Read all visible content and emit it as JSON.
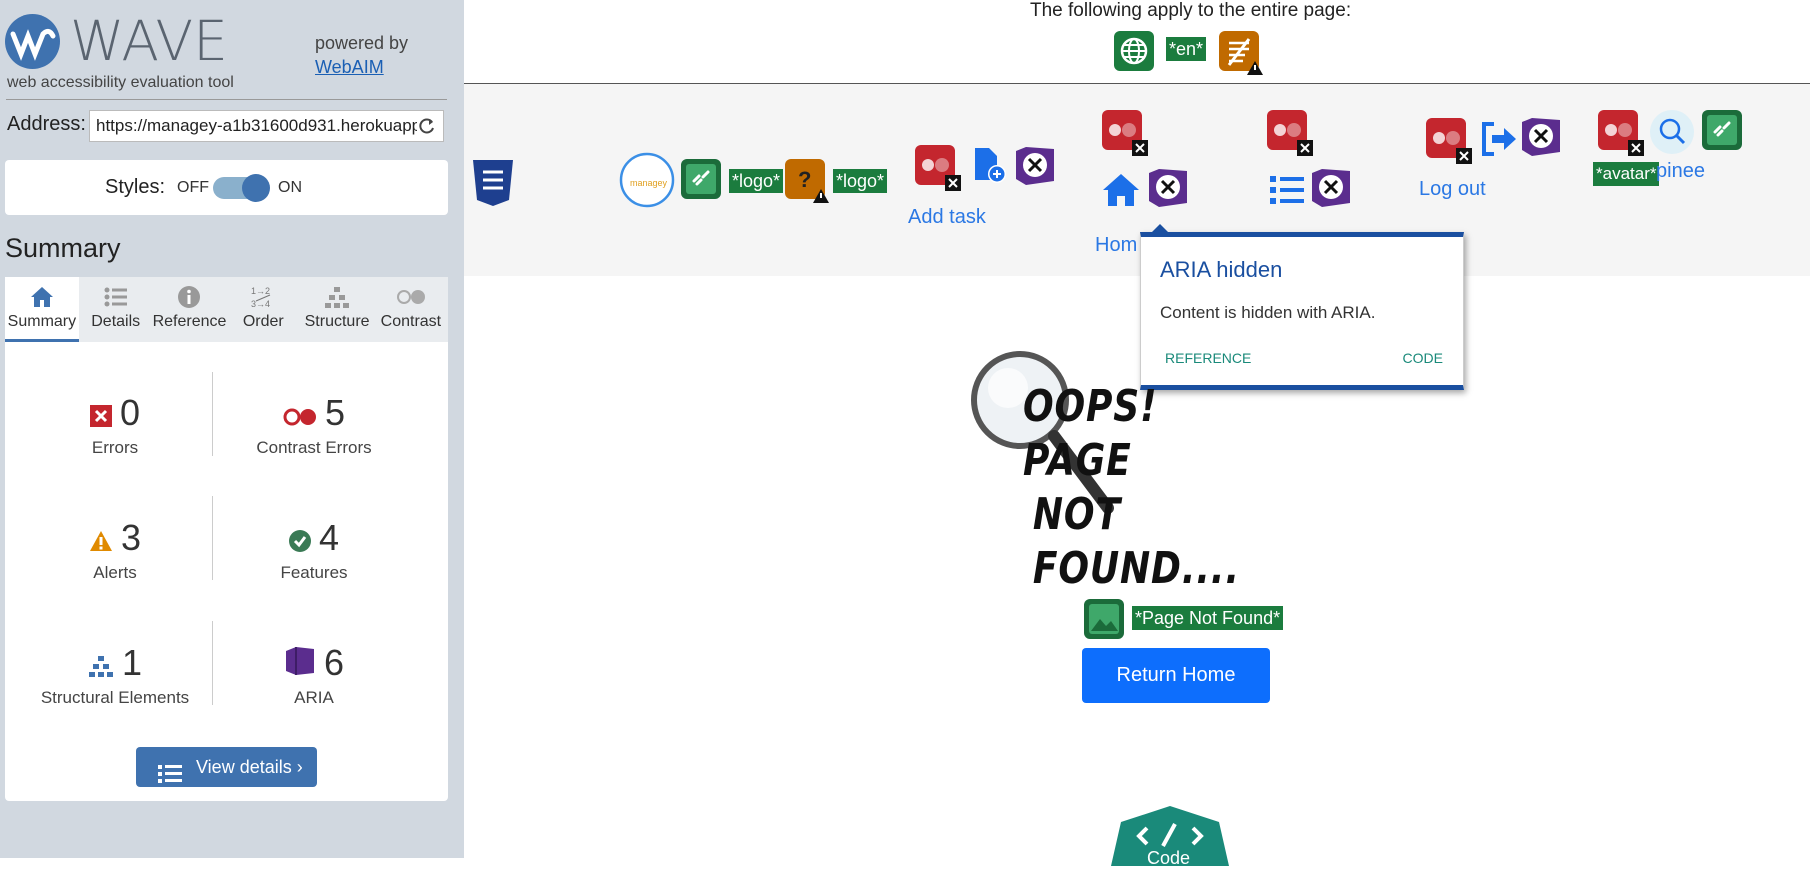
{
  "sidebar": {
    "logo_text": "WAVE",
    "logo_subtitle": "web accessibility evaluation tool",
    "powered_by": "powered by",
    "webaim_link": "WebAIM",
    "address_label": "Address:",
    "address_value": "https://managey-a1b31600d931.herokuapp",
    "styles_label": "Styles:",
    "styles_off": "OFF",
    "styles_on": "ON",
    "styles_state": "on",
    "summary_heading": "Summary",
    "tabs": [
      {
        "label": "Summary",
        "icon": "home-icon",
        "active": true
      },
      {
        "label": "Details",
        "icon": "list-icon",
        "active": false
      },
      {
        "label": "Reference",
        "icon": "info-icon",
        "active": false
      },
      {
        "label": "Order",
        "icon": "order-icon",
        "active": false
      },
      {
        "label": "Structure",
        "icon": "structure-icon",
        "active": false
      },
      {
        "label": "Contrast",
        "icon": "contrast-icon",
        "active": false
      }
    ],
    "stats": {
      "errors": {
        "count": "0",
        "label": "Errors"
      },
      "contrast_errors": {
        "count": "5",
        "label": "Contrast Errors"
      },
      "alerts": {
        "count": "3",
        "label": "Alerts"
      },
      "features": {
        "count": "4",
        "label": "Features"
      },
      "structural": {
        "count": "1",
        "label": "Structural Elements"
      },
      "aria": {
        "count": "6",
        "label": "ARIA"
      }
    },
    "view_details": "View details ›"
  },
  "main": {
    "banner_text": "The following apply to the entire page:",
    "lang_tag": "*en*",
    "tags": {
      "logo1": "*logo*",
      "logo2": "*logo*",
      "avatar": "*avatar*",
      "page_not_found": "*Page Not Found*"
    },
    "nav": {
      "add_task": "Add task",
      "home": "Hom",
      "logout": "Log out",
      "user": "pinee"
    },
    "tooltip": {
      "title": "ARIA hidden",
      "body": "Content is hidden with ARIA.",
      "reference": "REFERENCE",
      "code": "CODE"
    },
    "oops_line1": "OOPS! PAGE",
    "oops_line2": "NOT FOUND....",
    "return_button": "Return Home",
    "code_tab": "Code"
  },
  "colors": {
    "wave_blue": "#3f72af",
    "feature_green": "#1b7c3e",
    "contrast_red": "#c4262e",
    "aria_purple": "#5b2d8e",
    "alert_orange": "#e08a00",
    "button_blue": "#0d6efd"
  }
}
